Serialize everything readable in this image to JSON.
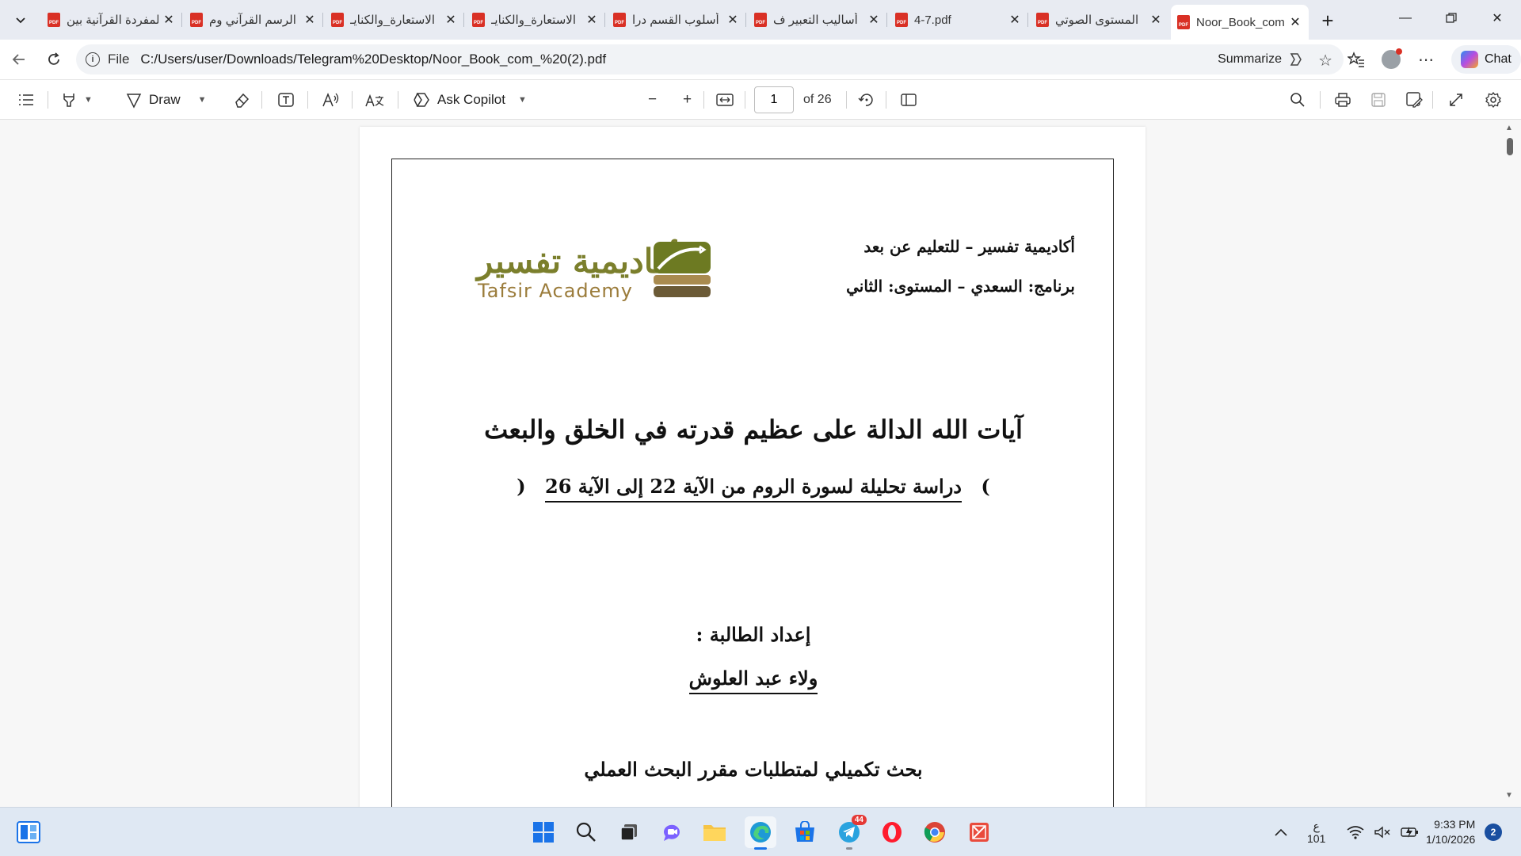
{
  "browser": {
    "tabs": [
      {
        "label": "المفردة القرآنية بين"
      },
      {
        "label": "الرسم القرآني وم"
      },
      {
        "label": "الاستعارة_والكنايـ"
      },
      {
        "label": "الاستعارة_والكنايـ"
      },
      {
        "label": "أسلوب القسم درا"
      },
      {
        "label": "أساليب التعبير ف"
      },
      {
        "label": "4-7.pdf"
      },
      {
        "label": "المستوى الصوتي"
      },
      {
        "label": "Noor_Book_com"
      }
    ],
    "pdf_badge": "PDF",
    "address": {
      "scheme": "File",
      "url": "C:/Users/user/Downloads/Telegram%20Desktop/Noor_Book_com_%20(2).pdf",
      "summarize_label": "Summarize"
    },
    "chat_label": "Chat"
  },
  "pdf_toolbar": {
    "draw_label": "Draw",
    "ask_copilot_label": "Ask Copilot",
    "page_current": "1",
    "page_total": "of 26"
  },
  "document": {
    "header_right_line1": "أكاديمية تفسير – للتعليم عن بعد",
    "header_right_line2": "برنامج: السعدي – المستوى: الثاني",
    "logo_arabic": "أكاديمية تفسير",
    "logo_english": "Tafsir Academy",
    "title": "آيات الله الدالة على عظيم قدرته في الخلق والبعث",
    "subtitle": "دراسة تحليلة لسورة الروم من الآية 22 إلى الآية 26",
    "paren_open": "(",
    "paren_close": ")",
    "prepared_by_label": "إعداد الطالبة :",
    "student_name": "ولاء عبد العلوش",
    "research_note": "بحث تكميلي لمتطلبات مقرر البحث العملي"
  },
  "taskbar": {
    "telegram_badge": "44",
    "ime_char": "ع",
    "ime_num": "101",
    "time": "9:33 PM",
    "date": "1/10/2026",
    "notification_count": "2"
  }
}
